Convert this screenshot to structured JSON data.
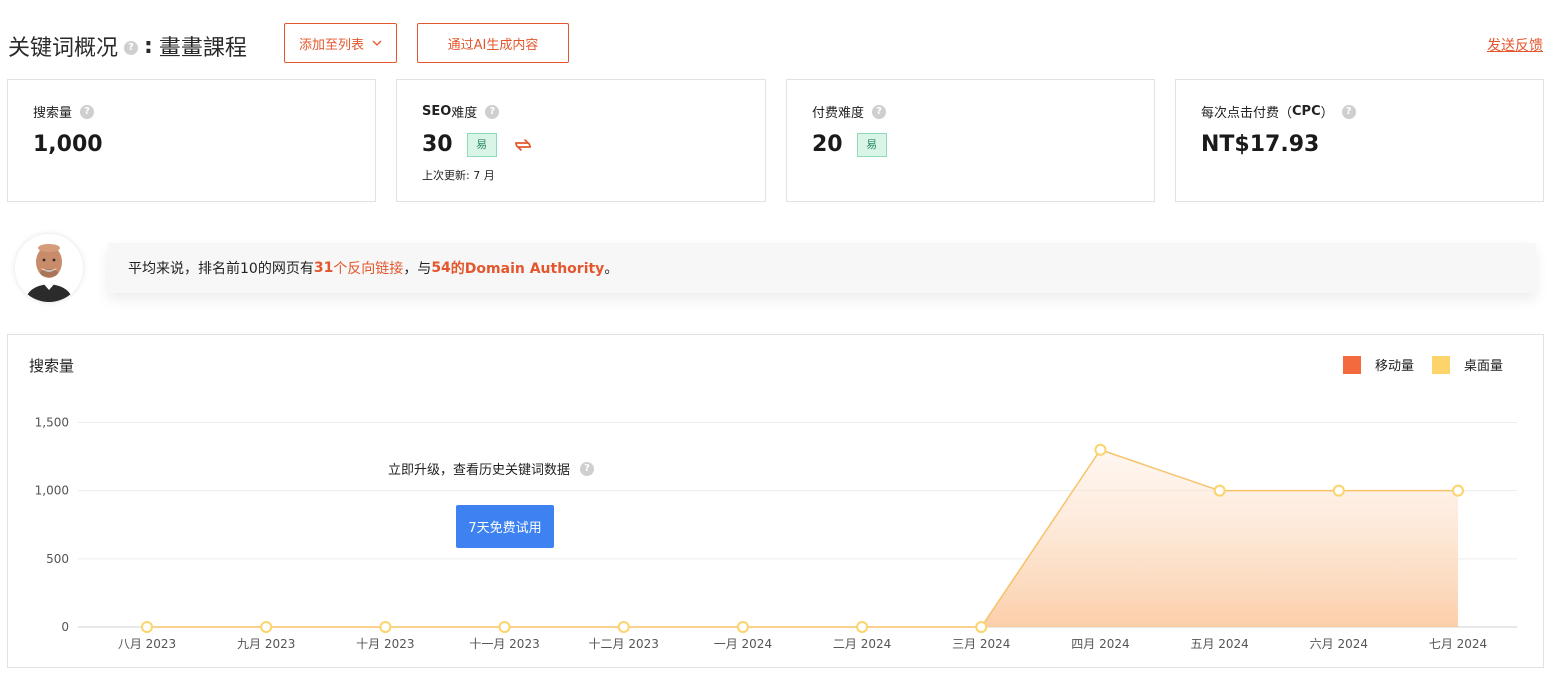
{
  "header": {
    "title": "关键词概况",
    "help_glyph": "?",
    "colon": ":",
    "keyword": "畫畫課程",
    "add_to_list_label": "添加至列表",
    "ai_generate_label": "通过AI生成内容",
    "feedback_label": "发送反馈"
  },
  "metrics": [
    {
      "label": "搜索量",
      "value": "1,000"
    },
    {
      "label_bold": "SEO",
      "label": "难度",
      "value": "30",
      "badge": "易",
      "sub": "上次更新: 7 月"
    },
    {
      "label": "付费难度",
      "value": "20",
      "badge": "易"
    },
    {
      "label_pre": "每次点击付费（",
      "label_bold": "CPC",
      "label_post": "）",
      "value": "NT$17.93"
    }
  ],
  "banner": {
    "part1": "平均来说，排名前10的网页有",
    "backlinks_count": "31",
    "backlinks_label": "个反向链接",
    "part2": "，与",
    "da_value": "54",
    "da_label": "的Domain Authority",
    "part3": "。"
  },
  "chart_section": {
    "upgrade_text": "立即升级，查看历史关键词数据",
    "trial_button": "7天免费试用"
  },
  "colors": {
    "accent": "#e4572e",
    "mobile": "#f26a3d",
    "desktop": "#fdd36b",
    "trial": "#3d82f0"
  },
  "chart_data": {
    "type": "area",
    "title": "搜索量",
    "categories": [
      "八月 2023",
      "九月 2023",
      "十月 2023",
      "十一月 2023",
      "十二月 2023",
      "一月 2024",
      "二月 2024",
      "三月 2024",
      "四月 2024",
      "五月 2024",
      "六月 2024",
      "七月 2024"
    ],
    "series": [
      {
        "name": "移动量",
        "values": [
          0,
          0,
          0,
          0,
          0,
          0,
          0,
          0,
          0,
          0,
          0,
          0
        ]
      },
      {
        "name": "桌面量",
        "values": [
          0,
          0,
          0,
          0,
          0,
          0,
          0,
          0,
          1300,
          1000,
          1000,
          1000
        ]
      }
    ],
    "yticks": [
      "1,500",
      "1,000",
      "500",
      "0"
    ],
    "ylim": [
      0,
      1500
    ],
    "grid": true,
    "legend": "top-right"
  }
}
